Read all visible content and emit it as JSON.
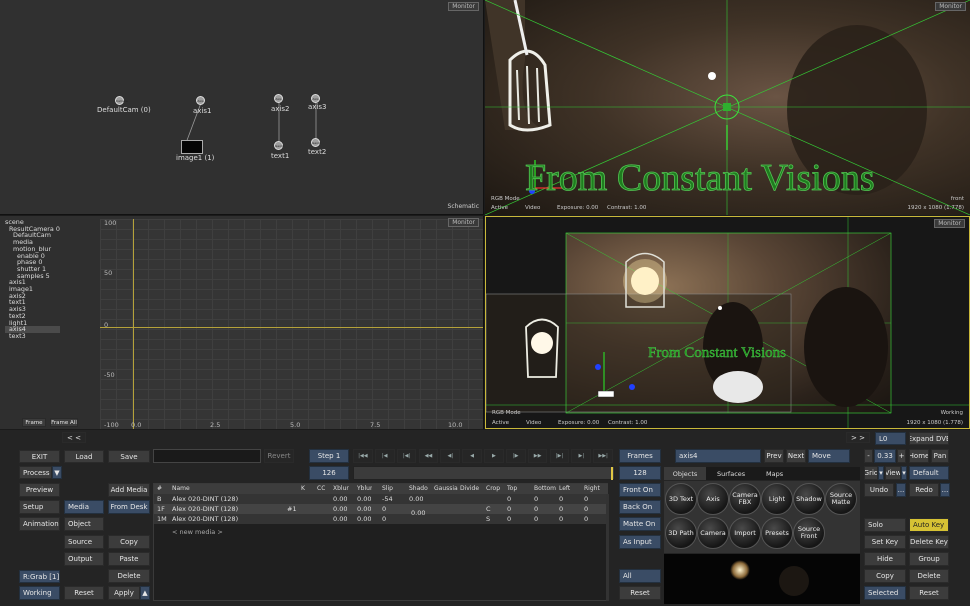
{
  "schematic": {
    "monitor": "Monitor",
    "label": "Schematic",
    "nodes": [
      {
        "icon": "Camera",
        "label": "DefaultCam (0)"
      },
      {
        "icon": "Axis",
        "label": "axis1"
      },
      {
        "icon": "",
        "label": "image1 (1)"
      },
      {
        "icon": "Axis",
        "label": "axis2"
      },
      {
        "icon": "Axis",
        "label": "axis3"
      },
      {
        "icon": "Geom",
        "label": "text1"
      },
      {
        "icon": "Geom",
        "label": "text2"
      }
    ]
  },
  "front_view": {
    "monitor": "Monitor",
    "overlay_text": "From Constant Visions",
    "rgb": "RGB Mode",
    "active": "Active",
    "video": "Video",
    "exposure": "Exposure: 0.00",
    "contrast": "Contrast: 1.00",
    "view_name": "front",
    "resolution": "1920 x 1080 (1.778)"
  },
  "animation": {
    "monitor": "Monitor",
    "tree": [
      "scene",
      "ResultCamera 0",
      "DefaultCam",
      "media",
      "motion_blur",
      "enable 0",
      "phase 0",
      "shutter 1",
      "samples 5",
      "axis1",
      "image1",
      "axis2",
      "text1",
      "axis3",
      "text2",
      "light1",
      "axis4",
      "text3"
    ],
    "y_ticks": [
      "100",
      "50",
      "0",
      "-50",
      "-100"
    ],
    "x_ticks": [
      "0.0",
      "2.5",
      "5.0",
      "7.5",
      "10.0"
    ],
    "frame_btn": "Frame",
    "frame_all_btn": "Frame All"
  },
  "working_view": {
    "monitor": "Monitor",
    "overlay_text": "From Constant Visions",
    "rgb": "RGB Mode",
    "active": "Active",
    "video": "Video",
    "exposure": "Exposure: 0.00",
    "contrast": "Contrast: 1.00",
    "view_name": "Working",
    "resolution": "1920 x 1080 (1.778)"
  },
  "bottom": {
    "left": {
      "exit": "EXIT",
      "load": "Load",
      "save": "Save",
      "process": "Process",
      "preview": "Preview",
      "setup": "Setup",
      "animation": "Animation",
      "grab": "R:Grab [1]",
      "working": "Working",
      "reset": "Reset"
    },
    "media_col": {
      "media": "Media",
      "object": "Object",
      "source": "Source",
      "output": "Output",
      "add_media": "Add Media",
      "from_desk": "From Desk",
      "copy": "Copy",
      "paste": "Paste",
      "delete": "Delete",
      "apply": "Apply"
    },
    "revert": "Revert",
    "step": "Step 1",
    "frame_field": "126",
    "frames_btn": "Frames",
    "frames_value": "128",
    "table": {
      "headers": [
        "#",
        "Name",
        "K",
        "CC",
        "Xblur",
        "Yblur",
        "Slip",
        "Shado",
        "Gaussia",
        "Divide",
        "Crop",
        "Top",
        "Bottom",
        "Left",
        "Right"
      ],
      "rows": [
        [
          "B",
          "Alex 020-DINT (128)",
          "",
          "",
          "0.00",
          "0.00",
          "-54",
          "0.00",
          "",
          "",
          "",
          "0",
          "0",
          "0",
          "0"
        ],
        [
          "1F",
          "Alex 020-DINT (128)",
          "#1",
          "",
          "0.00",
          "0.00",
          "0",
          "",
          "",
          "",
          "C",
          "0",
          "0",
          "0",
          "0"
        ],
        [
          "1M",
          "Alex 020-DINT (128)",
          "",
          "",
          "0.00",
          "0.00",
          "0",
          "",
          "",
          "",
          "S",
          "0",
          "0",
          "0",
          "0"
        ]
      ],
      "merged_shado": "0.00",
      "new_media": "< new media >"
    },
    "side": {
      "front_on": "Front On",
      "back_on": "Back On",
      "matte_on": "Matte On",
      "as_input": "As Input",
      "all": "All",
      "reset": "Reset"
    },
    "objects": {
      "node_name": "axis4",
      "prev": "Prev",
      "next": "Next",
      "move": "Move",
      "tabs": [
        "Objects",
        "Surfaces",
        "Maps"
      ],
      "buttons": [
        "3D Text",
        "Axis",
        "Camera FBX",
        "Light",
        "Shadow",
        "Source Matte",
        "3D Path",
        "Camera",
        "Import",
        "Presets",
        "Source Front"
      ]
    },
    "right": {
      "lo": "L0",
      "expand": "Expand DVE",
      "minus": "-",
      "zoom": "0.33",
      "plus": "+",
      "home": "Home",
      "pan": "Pan",
      "grid": "Grid",
      "view": "View",
      "default": "Default",
      "undo": "Undo",
      "redo": "Redo",
      "solo": "Solo",
      "auto_key": "Auto Key",
      "set_key": "Set Key",
      "delete_key": "Delete Key",
      "hide": "Hide",
      "group": "Group",
      "copy": "Copy",
      "delete": "Delete",
      "selected": "Selected",
      "reset": "Reset",
      "ellipsis": "...",
      "nav_left": "< <",
      "nav_right": "> >"
    },
    "transport": [
      "|◀◀",
      "|◀",
      "|◀|",
      "◀◀",
      "◀|",
      "◀",
      "▶",
      "|▶",
      "▶▶",
      "|▶|",
      "▶|",
      "▶▶|"
    ]
  }
}
